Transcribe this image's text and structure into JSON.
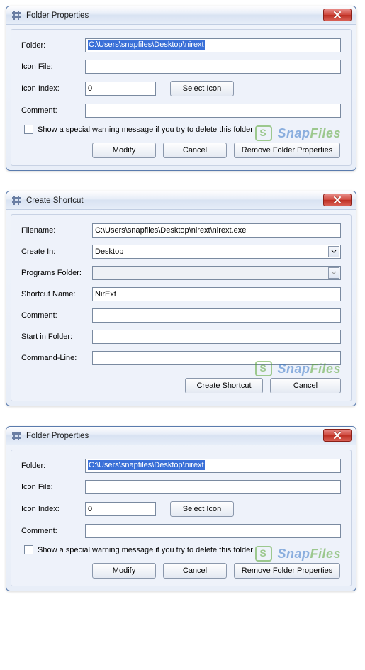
{
  "dialog1": {
    "title": "Folder Properties",
    "labels": {
      "folder": "Folder:",
      "iconFile": "Icon File:",
      "iconIndex": "Icon Index:",
      "comment": "Comment:"
    },
    "values": {
      "folder": "C:\\Users\\snapfiles\\Desktop\\nirext",
      "iconFile": "",
      "iconIndex": "0",
      "comment": ""
    },
    "buttons": {
      "selectIcon": "Select Icon",
      "modify": "Modify",
      "cancel": "Cancel",
      "remove": "Remove Folder Properties"
    },
    "checkboxLabel": "Show a special warning message if you try to delete this folder"
  },
  "dialog2": {
    "title": "Create Shortcut",
    "labels": {
      "filename": "Filename:",
      "createIn": "Create In:",
      "programsFolder": "Programs Folder:",
      "shortcutName": "Shortcut Name:",
      "comment": "Comment:",
      "startIn": "Start in Folder:",
      "cmdLine": "Command-Line:"
    },
    "values": {
      "filename": "C:\\Users\\snapfiles\\Desktop\\nirext\\nirext.exe",
      "createIn": "Desktop",
      "programsFolder": "",
      "shortcutName": "NirExt",
      "comment": "",
      "startIn": "",
      "cmdLine": ""
    },
    "buttons": {
      "create": "Create Shortcut",
      "cancel": "Cancel"
    }
  },
  "dialog3": {
    "title": "Folder Properties",
    "labels": {
      "folder": "Folder:",
      "iconFile": "Icon File:",
      "iconIndex": "Icon Index:",
      "comment": "Comment:"
    },
    "values": {
      "folder": "C:\\Users\\snapfiles\\Desktop\\nirext",
      "iconFile": "",
      "iconIndex": "0",
      "comment": ""
    },
    "buttons": {
      "selectIcon": "Select Icon",
      "modify": "Modify",
      "cancel": "Cancel",
      "remove": "Remove Folder Properties"
    },
    "checkboxLabel": "Show a special warning message if you try to delete this folder"
  },
  "watermark": {
    "a": "Snap",
    "b": "Files"
  }
}
